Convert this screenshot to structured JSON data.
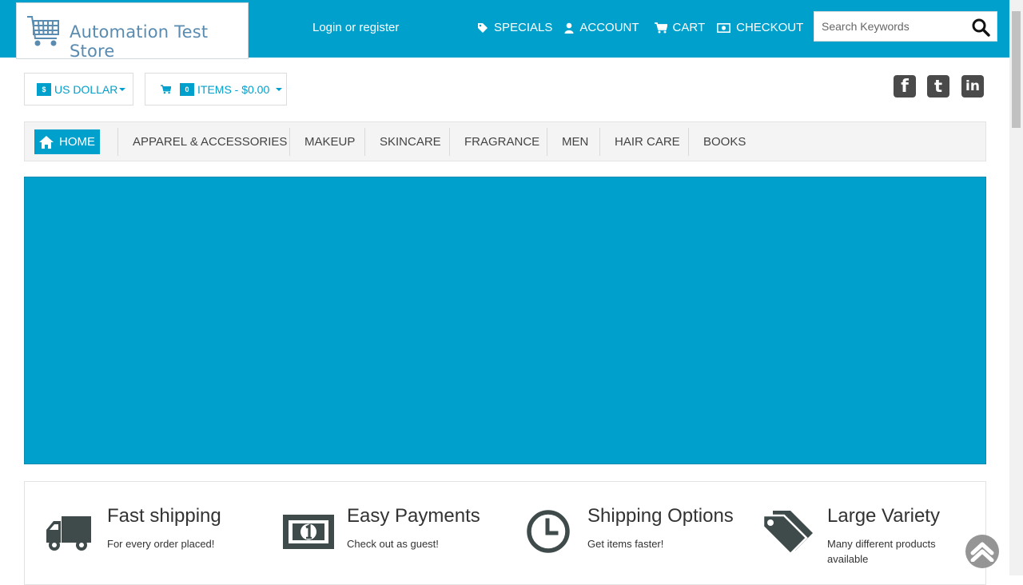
{
  "header": {
    "logo_text": "Automation Test Store",
    "login_label": "Login or register",
    "nav": [
      {
        "label": "SPECIALS",
        "icon": "tag-icon"
      },
      {
        "label": "ACCOUNT",
        "icon": "user-icon"
      },
      {
        "label": "CART",
        "icon": "cart-icon"
      },
      {
        "label": "CHECKOUT",
        "icon": "money-icon"
      }
    ],
    "search": {
      "placeholder": "Search Keywords",
      "value": ""
    }
  },
  "toolbar": {
    "currency_symbol": "$",
    "currency_label": "US DOLLAR",
    "cart_count": "0",
    "cart_label": "ITEMS - $0.00"
  },
  "social": {
    "facebook": "f",
    "twitter": "t",
    "linkedin": "in"
  },
  "categories": {
    "home": "HOME",
    "items": [
      "APPAREL & ACCESSORIES",
      "MAKEUP",
      "SKINCARE",
      "FRAGRANCE",
      "MEN",
      "HAIR CARE",
      "BOOKS"
    ]
  },
  "features": [
    {
      "title": "Fast shipping",
      "subtitle": "For every order placed!",
      "icon": "truck-icon"
    },
    {
      "title": "Easy Payments",
      "subtitle": "Check out as guest!",
      "icon": "banknote-icon"
    },
    {
      "title": "Shipping Options",
      "subtitle": "Get items faster!",
      "icon": "clock-icon"
    },
    {
      "title": "Large Variety",
      "subtitle": "Many different products available",
      "icon": "tags-icon"
    }
  ],
  "colors": {
    "accent": "#00a0cc",
    "icon_dark": "#3f4a4a"
  }
}
